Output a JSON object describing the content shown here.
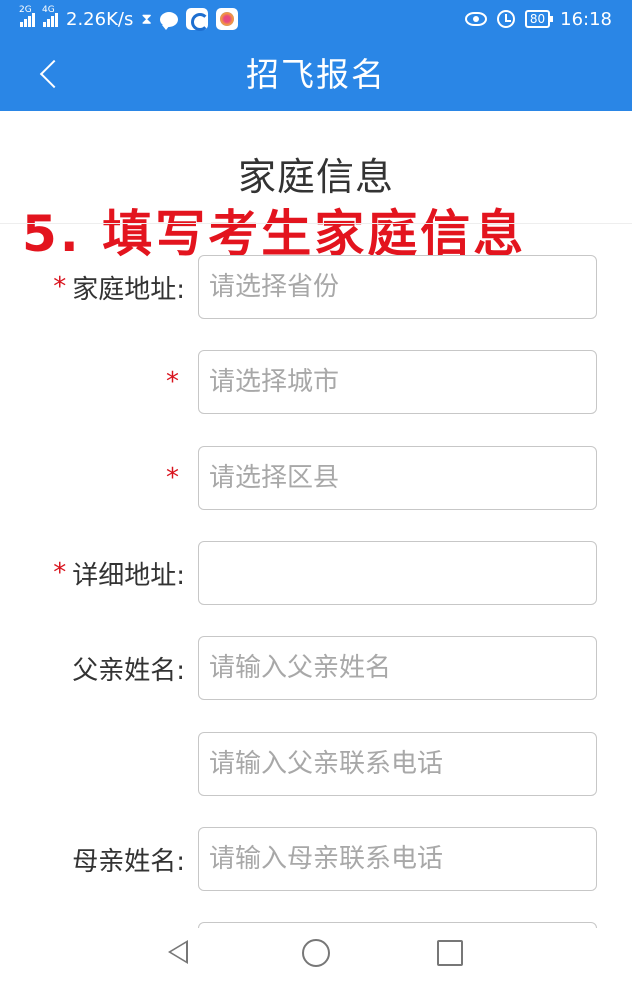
{
  "status_bar": {
    "signal1_tag": "2G",
    "signal2_tag": "4G",
    "net_speed": "2.26K/s",
    "battery": "80",
    "time": "16:18",
    "icons": [
      "hourglass-icon",
      "chat-icon",
      "app-icon",
      "app-icon",
      "eye-icon",
      "alarm-icon",
      "battery-icon"
    ]
  },
  "header": {
    "title": "招飞报名",
    "back_icon": "chevron-left-icon"
  },
  "section_title": "家庭信息",
  "overlay_note": "5. 填写考生家庭信息",
  "form": {
    "rows": [
      {
        "label": "家庭地址:",
        "required": "*",
        "placeholder": "请选择省份",
        "value": ""
      },
      {
        "label": "",
        "required": "*",
        "placeholder": "请选择城市",
        "value": ""
      },
      {
        "label": "",
        "required": "*",
        "placeholder": "请选择区县",
        "value": ""
      },
      {
        "label": "详细地址:",
        "required": "*",
        "placeholder": "",
        "value": ""
      },
      {
        "label": "父亲姓名:",
        "required": "",
        "placeholder": "请输入父亲姓名",
        "value": ""
      },
      {
        "label": "",
        "required": "",
        "placeholder": "请输入父亲联系电话",
        "value": ""
      },
      {
        "label": "母亲姓名:",
        "required": "",
        "placeholder": "请输入母亲联系电话",
        "value": ""
      },
      {
        "label": "",
        "required": "",
        "placeholder": "",
        "value": ""
      }
    ]
  },
  "nav_bar": {
    "icons": [
      "back-triangle-icon",
      "home-circle-icon",
      "recent-square-icon"
    ]
  },
  "colors": {
    "primary": "#2a86e6",
    "required": "#d9141e",
    "overlay": "#e3141e"
  }
}
